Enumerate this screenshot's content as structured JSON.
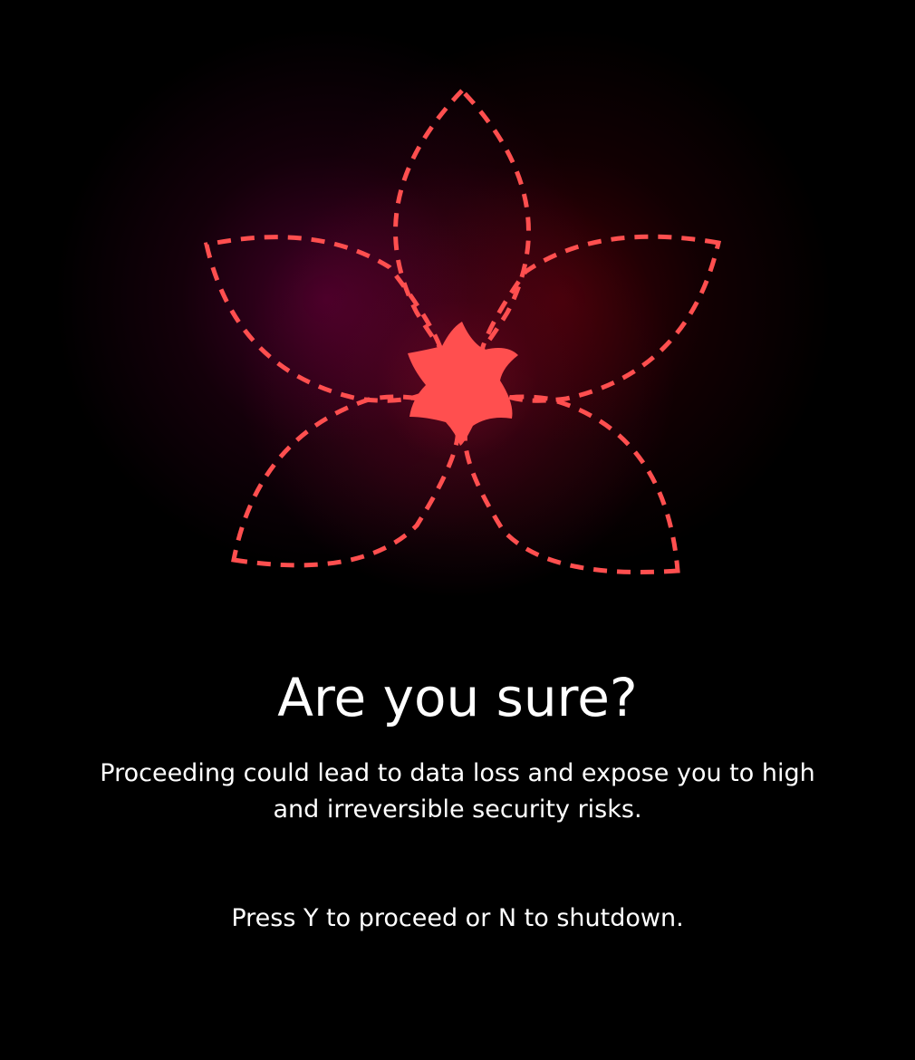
{
  "dialog": {
    "title": "Are you sure?",
    "message": "Proceeding could lead to data loss and expose you to high and irreversible security risks.",
    "prompt": "Press Y to proceed or N to shutdown."
  },
  "emblem": {
    "icon": "flower-icon",
    "accent_color": "#ff4f4f"
  }
}
